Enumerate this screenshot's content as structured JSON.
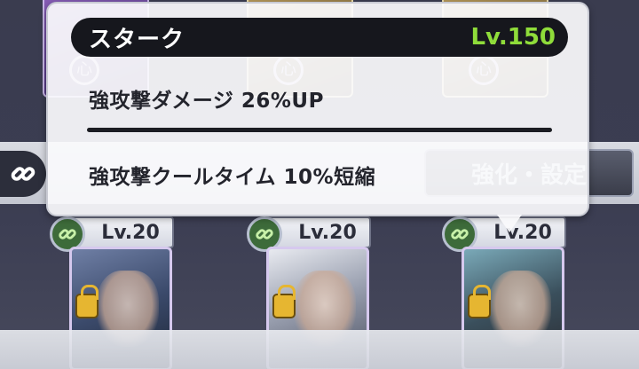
{
  "popup": {
    "character_name": "スターク",
    "level": "Lv.150",
    "effects": [
      "強攻撃ダメージ 26%UP",
      "強攻撃クールタイム 10%短縮"
    ],
    "colors": {
      "level": "#8fdc3a",
      "title_bar": "#16171d"
    }
  },
  "background": {
    "enhance_button_label": "強化・設定",
    "slot_levels": [
      "Lv.20",
      "Lv.20",
      "Lv.20"
    ],
    "card_symbol": "心"
  },
  "icons": [
    "link-icon",
    "lock-icon"
  ]
}
